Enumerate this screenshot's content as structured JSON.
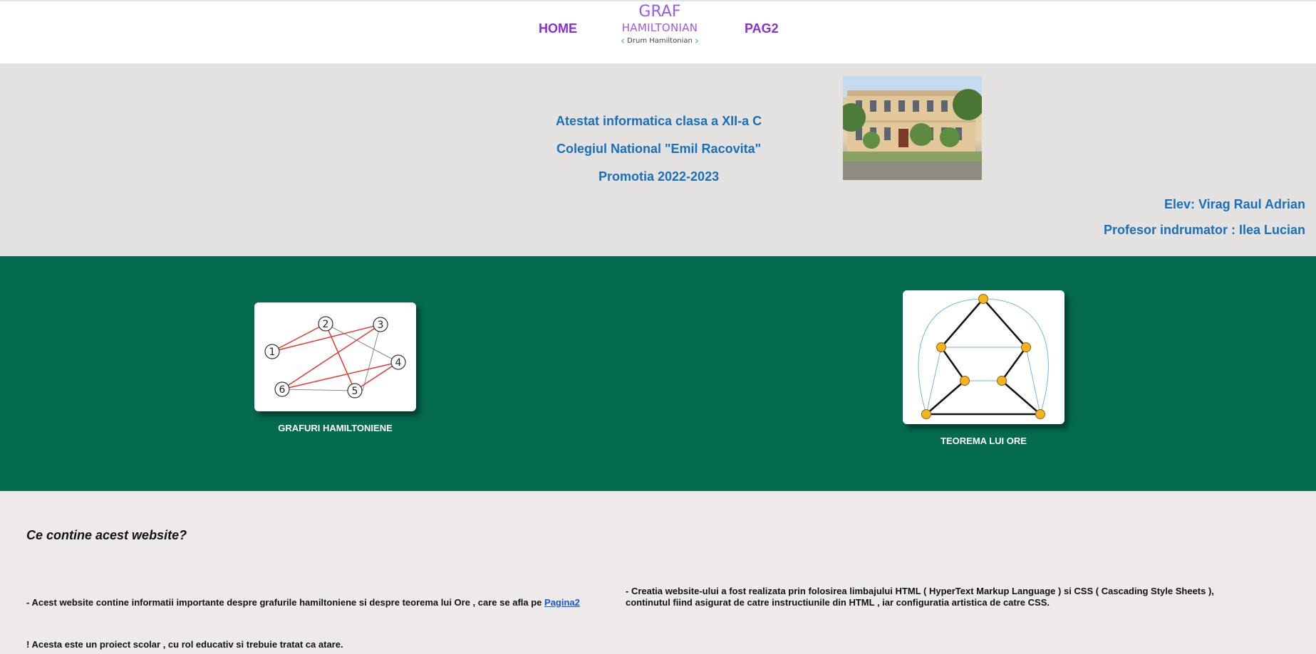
{
  "nav": {
    "home": "HOME",
    "pag2": "PAG2",
    "logo_line1": "GRAF",
    "logo_line2": "HAMILTONIAN",
    "logo_line3": "Drum Hamiltonian"
  },
  "hero": {
    "line1": "Atestat informatica clasa a XII-a C",
    "line2": "Colegiul National \"Emil Racovita\"",
    "line3": "Promotia 2022-2023",
    "student": "Elev: Virag Raul Adrian",
    "teacher": "Profesor indrumator : Ilea Lucian"
  },
  "cards": {
    "left_caption": "GRAFURI HAMILTONIENE",
    "right_caption": "TEOREMA LUI ORE",
    "graph_nodes": [
      "1",
      "2",
      "3",
      "4",
      "5",
      "6"
    ]
  },
  "content": {
    "question": "Ce contine acest website?",
    "para_left": "- Acest website contine informatii importante despre grafurile hamiltoniene si despre teorema lui Ore , care se afla pe",
    "link": "Pagina2",
    "para_right_1": "- Creatia website-ului a fost realizata prin folosirea limbajului HTML ( HyperText Markup Language ) si CSS ( Cascading Style Sheets ),",
    "para_right_2": "continutul fiind asigurat de catre instructiunile din HTML , iar configuratia artistica de catre CSS.",
    "note": "! Acesta este un proiect scolar , cu rol educativ si trebuie tratat ca atare."
  },
  "colors": {
    "nav": "#8b2fd3",
    "hero_text": "#1a70b8",
    "green_band": "#046b4f",
    "hero_bg": "#e4e2e1",
    "content_bg": "#efeaea"
  }
}
